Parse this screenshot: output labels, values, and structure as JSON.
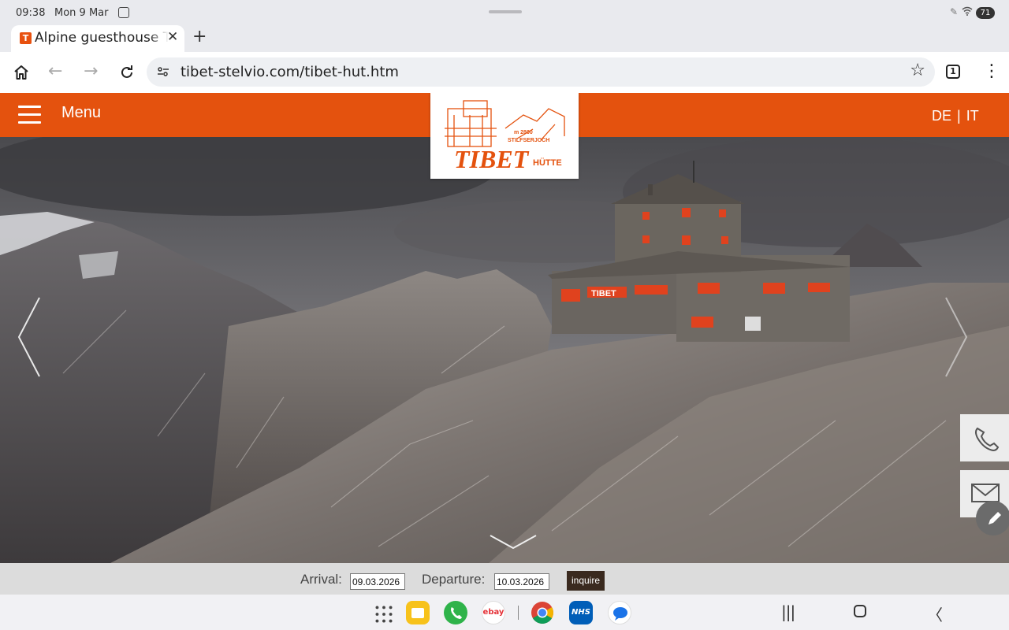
{
  "status_bar": {
    "time": "09:38",
    "date": "Mon 9 Mar",
    "battery": "71"
  },
  "browser": {
    "tab_title": "Alpine guesthouse Tibet hut",
    "tab_favicon": "T",
    "url": "tibet-stelvio.com/tibet-hut.htm",
    "tab_count": "1"
  },
  "site": {
    "menu_label": "Menu",
    "languages": [
      "DE",
      "IT"
    ],
    "language_separator": "|",
    "logo": {
      "main": "TIBET",
      "sub": "HÜTTE",
      "line1": "m 2800",
      "line2": "STILFSERJOCH"
    },
    "brand_color": "#e4520e"
  },
  "booking": {
    "arrival_label": "Arrival:",
    "arrival_value": "09.03.2026",
    "departure_label": "Departure:",
    "departure_value": "10.03.2026",
    "inquire_label": "inquire"
  },
  "dock_apps": [
    "app-drawer",
    "files",
    "phone",
    "ebay",
    "chrome",
    "nhs",
    "messages"
  ],
  "dock_labels": {
    "ebay": "ebay",
    "nhs": "NHS"
  }
}
